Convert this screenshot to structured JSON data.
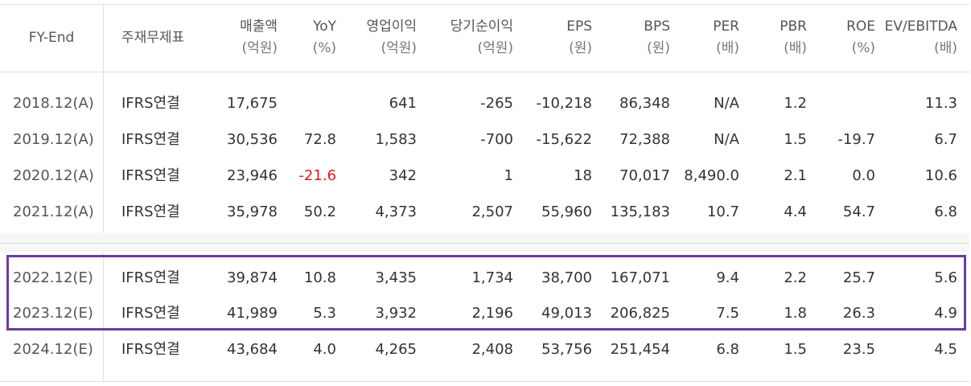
{
  "table": {
    "headers": [
      {
        "key": "fy_end",
        "label": "FY-End",
        "unit": ""
      },
      {
        "key": "standard",
        "label": "주재무제표",
        "unit": ""
      },
      {
        "key": "sales",
        "label": "매출액",
        "unit": "(억원)"
      },
      {
        "key": "yoy",
        "label": "YoY",
        "unit": "(%)"
      },
      {
        "key": "op_income",
        "label": "영업이익",
        "unit": "(억원)"
      },
      {
        "key": "net_income",
        "label": "당기순이익",
        "unit": "(억원)"
      },
      {
        "key": "eps",
        "label": "EPS",
        "unit": "(원)"
      },
      {
        "key": "bps",
        "label": "BPS",
        "unit": "(원)"
      },
      {
        "key": "per",
        "label": "PER",
        "unit": "(배)"
      },
      {
        "key": "pbr",
        "label": "PBR",
        "unit": "(배)"
      },
      {
        "key": "roe",
        "label": "ROE",
        "unit": "(%)"
      },
      {
        "key": "ev_ebitda",
        "label": "EV/EBITDA",
        "unit": "(배)"
      }
    ],
    "rows": [
      {
        "fy_end": "2018.12(A)",
        "standard": "IFRS연결",
        "sales": "17,675",
        "yoy": "",
        "op_income": "641",
        "net_income": "-265",
        "eps": "-10,218",
        "bps": "86,348",
        "per": "N/A",
        "pbr": "1.2",
        "roe": "",
        "ev_ebitda": "11.3"
      },
      {
        "fy_end": "2019.12(A)",
        "standard": "IFRS연결",
        "sales": "30,536",
        "yoy": "72.8",
        "op_income": "1,583",
        "net_income": "-700",
        "eps": "-15,622",
        "bps": "72,388",
        "per": "N/A",
        "pbr": "1.5",
        "roe": "-19.7",
        "ev_ebitda": "6.7"
      },
      {
        "fy_end": "2020.12(A)",
        "standard": "IFRS연결",
        "sales": "23,946",
        "yoy": "-21.6",
        "op_income": "342",
        "net_income": "1",
        "eps": "18",
        "bps": "70,017",
        "per": "8,490.0",
        "pbr": "2.1",
        "roe": "0.0",
        "ev_ebitda": "10.6"
      },
      {
        "fy_end": "2021.12(A)",
        "standard": "IFRS연결",
        "sales": "35,978",
        "yoy": "50.2",
        "op_income": "4,373",
        "net_income": "2,507",
        "eps": "55,960",
        "bps": "135,183",
        "per": "10.7",
        "pbr": "4.4",
        "roe": "54.7",
        "ev_ebitda": "6.8"
      },
      {
        "fy_end": "2022.12(E)",
        "standard": "IFRS연결",
        "sales": "39,874",
        "yoy": "10.8",
        "op_income": "3,435",
        "net_income": "1,734",
        "eps": "38,700",
        "bps": "167,071",
        "per": "9.4",
        "pbr": "2.2",
        "roe": "25.7",
        "ev_ebitda": "5.6"
      },
      {
        "fy_end": "2023.12(E)",
        "standard": "IFRS연결",
        "sales": "41,989",
        "yoy": "5.3",
        "op_income": "3,932",
        "net_income": "2,196",
        "eps": "49,013",
        "bps": "206,825",
        "per": "7.5",
        "pbr": "1.8",
        "roe": "26.3",
        "ev_ebitda": "4.9"
      },
      {
        "fy_end": "2024.12(E)",
        "standard": "IFRS연결",
        "sales": "43,684",
        "yoy": "4.0",
        "op_income": "4,265",
        "net_income": "2,408",
        "eps": "53,756",
        "bps": "251,454",
        "per": "6.8",
        "pbr": "1.5",
        "roe": "23.5",
        "ev_ebitda": "4.5"
      }
    ]
  },
  "colors": {
    "highlight_border": "#6b3aa0",
    "negative_highlight": "#e0191b"
  }
}
